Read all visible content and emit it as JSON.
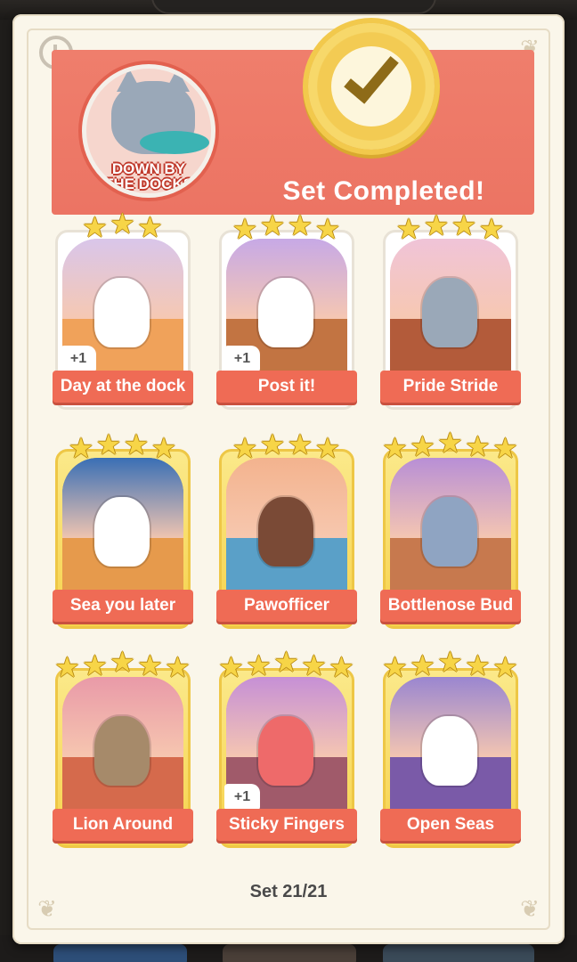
{
  "header": {
    "set_name": "DOWN BY\nTHE DOCKS",
    "status": "Set Completed!"
  },
  "cards": [
    {
      "name": "Day at the dock",
      "stars": 3,
      "gold": false,
      "plus": "+1",
      "sky": "#d9c6ea",
      "ground": "#f0a25a",
      "subject": "#ffffff"
    },
    {
      "name": "Post it!",
      "stars": 4,
      "gold": false,
      "plus": "+1",
      "sky": "#c7a9e6",
      "ground": "#c27442",
      "subject": "#ffffff"
    },
    {
      "name": "Pride Stride",
      "stars": 4,
      "gold": false,
      "plus": "",
      "sky": "#f0c4d8",
      "ground": "#b35b3a",
      "subject": "#9aa8b8"
    },
    {
      "name": "Sea you later",
      "stars": 4,
      "gold": true,
      "plus": "",
      "sky": "#3a6fb5",
      "ground": "#e69a4c",
      "subject": "#ffffff"
    },
    {
      "name": "Pawofficer",
      "stars": 4,
      "gold": true,
      "plus": "",
      "sky": "#f3b38e",
      "ground": "#5aa0c8",
      "subject": "#7a4a36"
    },
    {
      "name": "Bottlenose Bud",
      "stars": 5,
      "gold": true,
      "plus": "",
      "sky": "#b88fd6",
      "ground": "#c7794e",
      "subject": "#8fa4c2"
    },
    {
      "name": "Lion Around",
      "stars": 5,
      "gold": true,
      "plus": "",
      "sky": "#e99aa8",
      "ground": "#d56a4c",
      "subject": "#a68a6a"
    },
    {
      "name": "Sticky Fingers",
      "stars": 5,
      "gold": true,
      "plus": "+1",
      "sky": "#c690d6",
      "ground": "#a05a6a",
      "subject": "#ee6a6a"
    },
    {
      "name": "Open Seas",
      "stars": 5,
      "gold": true,
      "plus": "",
      "sky": "#9a86d0",
      "ground": "#7a5aa8",
      "subject": "#ffffff"
    }
  ],
  "footer": {
    "set_count": "Set 21/21"
  }
}
